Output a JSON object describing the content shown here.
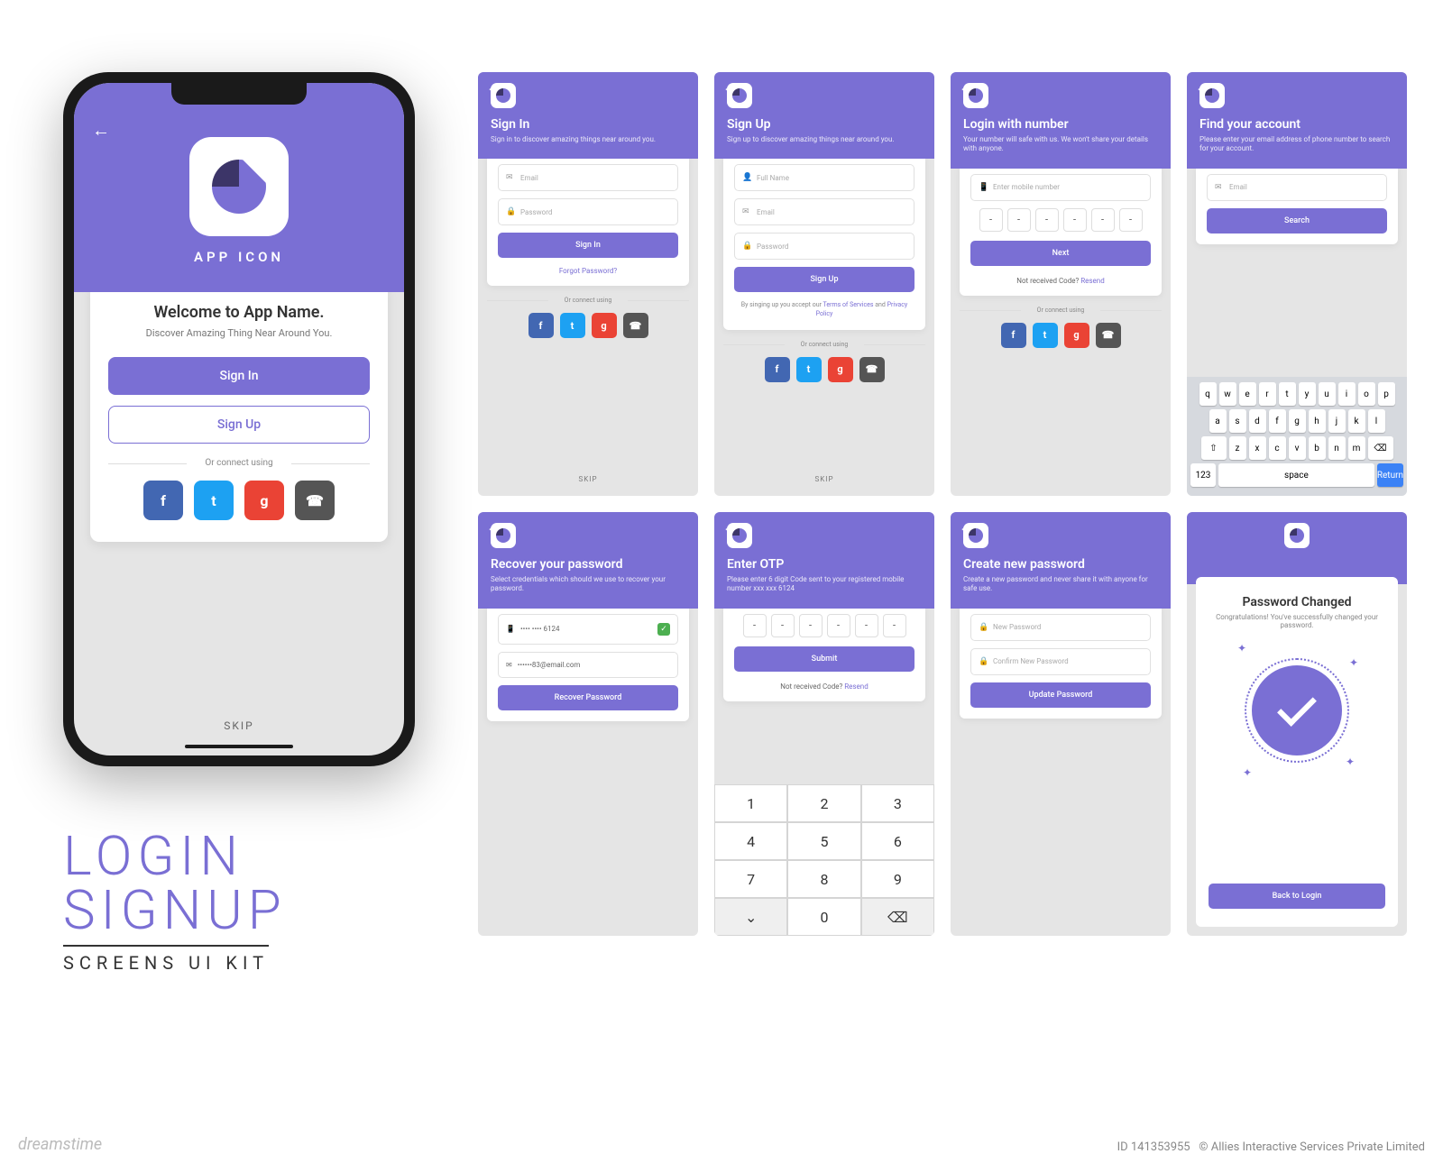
{
  "colors": {
    "accent": "#7a6fd4",
    "dark": "#3c3568"
  },
  "phone": {
    "app_icon_label": "APP ICON",
    "welcome_title": "Welcome to App Name.",
    "welcome_sub": "Discover Amazing Thing Near Around You.",
    "signin": "Sign In",
    "signup": "Sign Up",
    "or_connect": "Or connect using",
    "skip": "SKIP"
  },
  "social": [
    "f",
    "t",
    "g",
    "☎"
  ],
  "screens": {
    "signin": {
      "title": "Sign In",
      "sub": "Sign in to discover amazing things near around you.",
      "email": "Email",
      "password": "Password",
      "btn": "Sign In",
      "forgot": "Forgot Password?",
      "or": "Or connect using",
      "skip": "SKIP"
    },
    "signup": {
      "title": "Sign Up",
      "sub": "Sign up to discover amazing things near around you.",
      "fullname": "Full Name",
      "email": "Email",
      "password": "Password",
      "btn": "Sign Up",
      "terms_pre": "By singing up you accept our ",
      "terms": "Terms of Services",
      "terms_mid": " and ",
      "privacy": "Privacy Policy",
      "or": "Or connect using",
      "skip": "SKIP"
    },
    "login_number": {
      "title": "Login with number",
      "sub": "Your number will safe with us. We won't share your details with anyone.",
      "mobile": "Enter mobile number",
      "btn": "Next",
      "notreceived": "Not received Code? ",
      "resend": "Resend",
      "or": "Or connect using"
    },
    "find_account": {
      "title": "Find your account",
      "sub": "Please enter your email address of phone number to search for your account.",
      "email": "Email",
      "btn": "Search"
    },
    "recover": {
      "title": "Recover your password",
      "sub": "Select credentials which should we use to recover your password.",
      "phone_masked": "•••• •••• 6124",
      "email_masked": "••••••83@email.com",
      "btn": "Recover Password"
    },
    "otp": {
      "title": "Enter OTP",
      "sub": "Please enter 6 digit Code sent to your registered mobile number xxx xxx 6124",
      "btn": "Submit",
      "notreceived": "Not received Code? ",
      "resend": "Resend"
    },
    "create_pw": {
      "title": "Create new password",
      "sub": "Create a new password and never share it with anyone for safe use.",
      "new": "New Password",
      "confirm": "Confirm New Password",
      "btn": "Update Password"
    },
    "success": {
      "title": "Password Changed",
      "sub": "Congratulations! You've successfully changed your password.",
      "btn": "Back to Login"
    }
  },
  "keyboard": {
    "row1": [
      "q",
      "w",
      "e",
      "r",
      "t",
      "y",
      "u",
      "i",
      "o",
      "p"
    ],
    "row2": [
      "a",
      "s",
      "d",
      "f",
      "g",
      "h",
      "j",
      "k",
      "l"
    ],
    "row3": [
      "⇧",
      "z",
      "x",
      "c",
      "v",
      "b",
      "n",
      "m",
      "⌫"
    ],
    "row4": {
      "num": "123",
      "space": "space",
      "return": "Return"
    }
  },
  "numpad": [
    [
      "1",
      "2",
      "3"
    ],
    [
      "4",
      "5",
      "6"
    ],
    [
      "7",
      "8",
      "9"
    ],
    [
      "⌄",
      "0",
      "⌫"
    ]
  ],
  "kit": {
    "line1": "LOGIN",
    "line2": "SIGNUP",
    "line3": "SCREENS UI KIT"
  },
  "footer": {
    "logo": "dreamstime",
    "id": "ID 141353955",
    "copyright": "© Allies Interactive Services Private Limited"
  }
}
